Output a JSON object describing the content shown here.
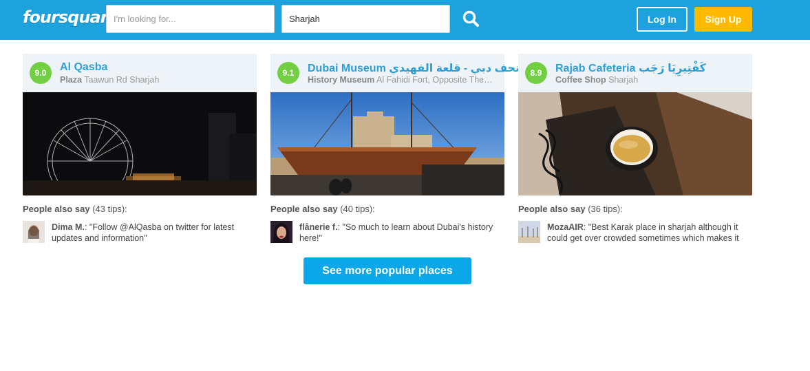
{
  "header": {
    "logo": "foursquare",
    "query_placeholder": "I'm looking for...",
    "query_value": "",
    "near_value": "Sharjah",
    "search_icon": "magnifier-icon",
    "login_label": "Log In",
    "signup_label": "Sign Up",
    "colors": {
      "bar": "#1da2dd",
      "signup": "#ffb900"
    }
  },
  "venues": [
    {
      "score": "9.0",
      "name": "Al Qasba",
      "category": "Plaza",
      "address": "Taawun Rd Sharjah",
      "tips_label": "People also say",
      "tips_count": "(43 tips):",
      "tip_user": "Dima M.",
      "tip_text": ": \"Follow @AlQasba on twitter for latest updates and information\""
    },
    {
      "score": "9.1",
      "name": "Dubai Museum متحف دبي - قلعة الفهيدي",
      "category": "History Museum",
      "address": "Al Fahidi Fort, Opposite The Grand Mosque",
      "tips_label": "People also say",
      "tips_count": "(40 tips):",
      "tip_user": "flânerie f.",
      "tip_text": ": \"So much to learn about Dubai's history here!\""
    },
    {
      "score": "8.9",
      "name": "Rajab Cafeteria كَفْتِيرِيَا رَجَب",
      "category": "Coffee Shop",
      "address": "Sharjah",
      "tips_label": "People also say",
      "tips_count": "(36 tips):",
      "tip_user": "MozaAIR",
      "tip_text": ": \"Best Karak place in sharjah although it could get over crowded sometimes which makes it hard to park\""
    }
  ],
  "score_color": "#73cf42",
  "more_label": "See more popular places"
}
